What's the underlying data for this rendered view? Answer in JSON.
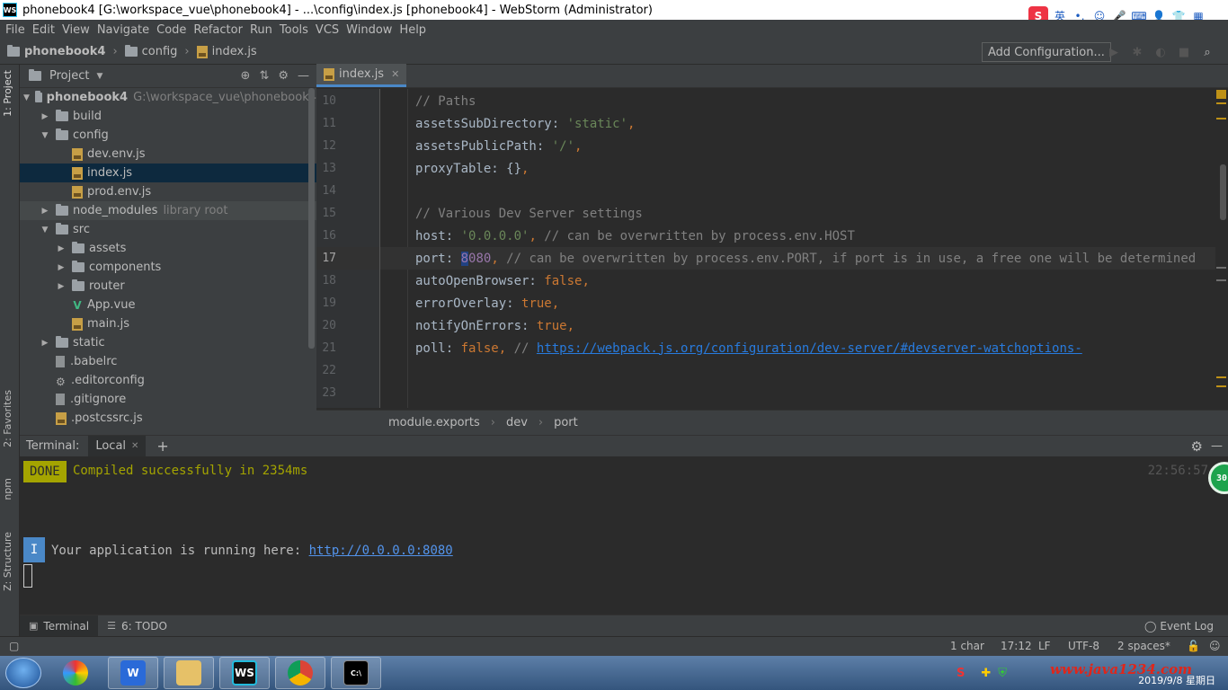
{
  "titlebar": {
    "logo": "WS",
    "title": "phonebook4 [G:\\workspace_vue\\phonebook4] - ...\\config\\index.js [phonebook4] - WebStorm (Administrator)"
  },
  "ime": {
    "lang": "英"
  },
  "menu": [
    "File",
    "Edit",
    "View",
    "Navigate",
    "Code",
    "Refactor",
    "Run",
    "Tools",
    "VCS",
    "Window",
    "Help"
  ],
  "nav": {
    "project": "phonebook4",
    "folder": "config",
    "file": "index.js",
    "add_config": "Add Configuration..."
  },
  "left_strip": {
    "project_tab": "1: Project",
    "favorites_tab": "2: Favorites",
    "npm_tab": "npm",
    "structure_tab": "Z: Structure"
  },
  "project_panel": {
    "title": "Project",
    "root_name": "phonebook4",
    "root_path": "G:\\workspace_vue\\phonebook4",
    "items": [
      {
        "label": "build"
      },
      {
        "label": "config"
      },
      {
        "label": "dev.env.js"
      },
      {
        "label": "index.js"
      },
      {
        "label": "prod.env.js"
      },
      {
        "label": "node_modules",
        "note": "library root"
      },
      {
        "label": "src"
      },
      {
        "label": "assets"
      },
      {
        "label": "components"
      },
      {
        "label": "router"
      },
      {
        "label": "App.vue"
      },
      {
        "label": "main.js"
      },
      {
        "label": "static"
      },
      {
        "label": ".babelrc"
      },
      {
        "label": ".editorconfig"
      },
      {
        "label": ".gitignore"
      },
      {
        "label": ".postcssrc.js"
      }
    ]
  },
  "editor": {
    "tab_label": "index.js",
    "current_line": "17",
    "lines": [
      {
        "n": "10",
        "parts": [
          {
            "t": "// Paths",
            "c": "c-comment"
          }
        ]
      },
      {
        "n": "11",
        "parts": [
          {
            "t": "assetsSubDirectory: ",
            "c": "c-plain"
          },
          {
            "t": "'static'",
            "c": "c-str"
          },
          {
            "t": ",",
            "c": "c-kw"
          }
        ]
      },
      {
        "n": "12",
        "parts": [
          {
            "t": "assetsPublicPath: ",
            "c": "c-plain"
          },
          {
            "t": "'/'",
            "c": "c-str"
          },
          {
            "t": ",",
            "c": "c-kw"
          }
        ]
      },
      {
        "n": "13",
        "parts": [
          {
            "t": "proxyTable: {}",
            "c": "c-plain"
          },
          {
            "t": ",",
            "c": "c-kw"
          }
        ]
      },
      {
        "n": "14",
        "parts": []
      },
      {
        "n": "15",
        "parts": [
          {
            "t": "// Various Dev Server settings",
            "c": "c-comment"
          }
        ]
      },
      {
        "n": "16",
        "parts": [
          {
            "t": "host: ",
            "c": "c-plain"
          },
          {
            "t": "'0.0.0.0'",
            "c": "c-str"
          },
          {
            "t": ", ",
            "c": "c-kw"
          },
          {
            "t": "// can be overwritten by process.env.HOST",
            "c": "c-comment"
          }
        ]
      },
      {
        "n": "17",
        "parts": [
          {
            "t": "port: ",
            "c": "c-plain"
          },
          {
            "t": "8",
            "c": "c-prop selch"
          },
          {
            "t": "080",
            "c": "c-prop"
          },
          {
            "t": ", ",
            "c": "c-kw"
          },
          {
            "t": "// can be overwritten by process.env.PORT, if port is in use, a free one will be determined",
            "c": "c-comment"
          }
        ]
      },
      {
        "n": "18",
        "parts": [
          {
            "t": "autoOpenBrowser: ",
            "c": "c-plain"
          },
          {
            "t": "false",
            "c": "c-kw"
          },
          {
            "t": ",",
            "c": "c-kw"
          }
        ]
      },
      {
        "n": "19",
        "parts": [
          {
            "t": "errorOverlay: ",
            "c": "c-plain"
          },
          {
            "t": "true",
            "c": "c-kw"
          },
          {
            "t": ",",
            "c": "c-kw"
          }
        ]
      },
      {
        "n": "20",
        "parts": [
          {
            "t": "notifyOnErrors: ",
            "c": "c-plain"
          },
          {
            "t": "true",
            "c": "c-kw"
          },
          {
            "t": ",",
            "c": "c-kw"
          }
        ]
      },
      {
        "n": "21",
        "parts": [
          {
            "t": "poll: ",
            "c": "c-plain"
          },
          {
            "t": "false",
            "c": "c-kw"
          },
          {
            "t": ", ",
            "c": "c-kw"
          },
          {
            "t": "// ",
            "c": "c-comment"
          },
          {
            "t": "https://webpack.js.org/configuration/dev-server/#devserver-watchoptions-",
            "c": "c-link"
          }
        ]
      },
      {
        "n": "22",
        "parts": []
      },
      {
        "n": "23",
        "parts": []
      }
    ],
    "breadcrumbs": [
      "module.exports",
      "dev",
      "port"
    ]
  },
  "terminal": {
    "label": "Terminal:",
    "tab": "Local",
    "done": "DONE",
    "compiled": "Compiled successfully in 2354ms",
    "time": "22:56:57",
    "info_badge": "I",
    "running_text": "Your application is running here: ",
    "running_url": "http://0.0.0.0:8080",
    "side_badge": "30"
  },
  "bottom_tabs": {
    "terminal": "Terminal",
    "todo": "6: TODO",
    "event_log": "Event Log"
  },
  "status": {
    "chars": "1 char",
    "position": "17:12",
    "line_sep": "LF",
    "encoding": "UTF-8",
    "indent": "2 spaces*"
  },
  "taskbar": {
    "watermark": "www.java1234.com",
    "clock": "2019/9/8 星期日"
  }
}
